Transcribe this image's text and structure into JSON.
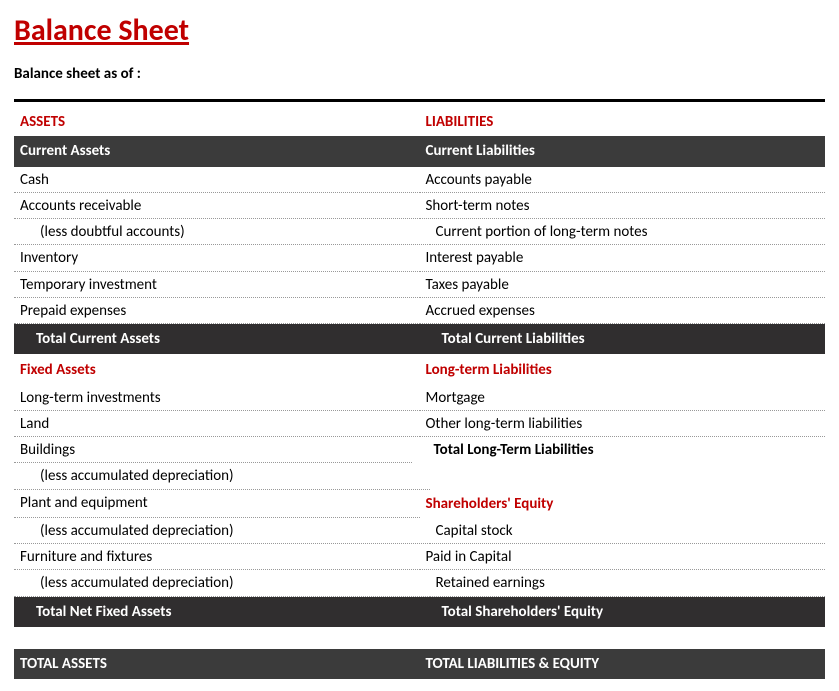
{
  "title": "Balance Sheet",
  "subtitle": "Balance sheet as of :",
  "labels": {
    "assets": "ASSETS",
    "liabilities": "LIABILITIES",
    "current_assets": "Current Assets",
    "current_liabilities": "Current Liabilities",
    "total_current_assets": "Total Current Assets",
    "total_current_liabilities": "Total Current Liabilities",
    "fixed_assets": "Fixed Assets",
    "long_term_liabilities": "Long-term Liabilities",
    "total_long_term_liabilities": "Total Long-Term Liabilities",
    "shareholders_equity": "Shareholders' Equity",
    "total_net_fixed_assets": "Total Net Fixed Assets",
    "total_shareholders_equity": "Total Shareholders' Equity",
    "total_assets": "TOTAL ASSETS",
    "total_liab_equity": "TOTAL LIABILITIES & EQUITY"
  },
  "assets": {
    "current": [
      {
        "label": "Cash"
      },
      {
        "label": "Accounts receivable"
      },
      {
        "label": "(less doubtful accounts)",
        "indent": true
      },
      {
        "label": "Inventory"
      },
      {
        "label": "Temporary investment"
      },
      {
        "label": "Prepaid expenses"
      }
    ],
    "fixed": [
      {
        "label": "Long-term investments"
      },
      {
        "label": "Land"
      },
      {
        "label": "Buildings"
      },
      {
        "label": "(less accumulated depreciation)",
        "indent": true
      },
      {
        "label": "Plant and equipment"
      },
      {
        "label": "(less accumulated depreciation)",
        "indent": true
      },
      {
        "label": "Furniture and fixtures"
      },
      {
        "label": "(less accumulated depreciation)",
        "indent": true
      }
    ]
  },
  "liabilities": {
    "current": [
      {
        "label": "Accounts payable"
      },
      {
        "label": "Short-term notes"
      },
      {
        "label": "Current portion of long-term notes"
      },
      {
        "label": "Interest payable"
      },
      {
        "label": "Taxes payable"
      },
      {
        "label": "Accrued expenses"
      }
    ],
    "long_term": [
      {
        "label": "Mortgage"
      },
      {
        "label": "Other long-term liabilities"
      }
    ],
    "equity": [
      {
        "label": "Capital stock"
      },
      {
        "label": "Paid in Capital"
      },
      {
        "label": "Retained earnings"
      }
    ]
  }
}
